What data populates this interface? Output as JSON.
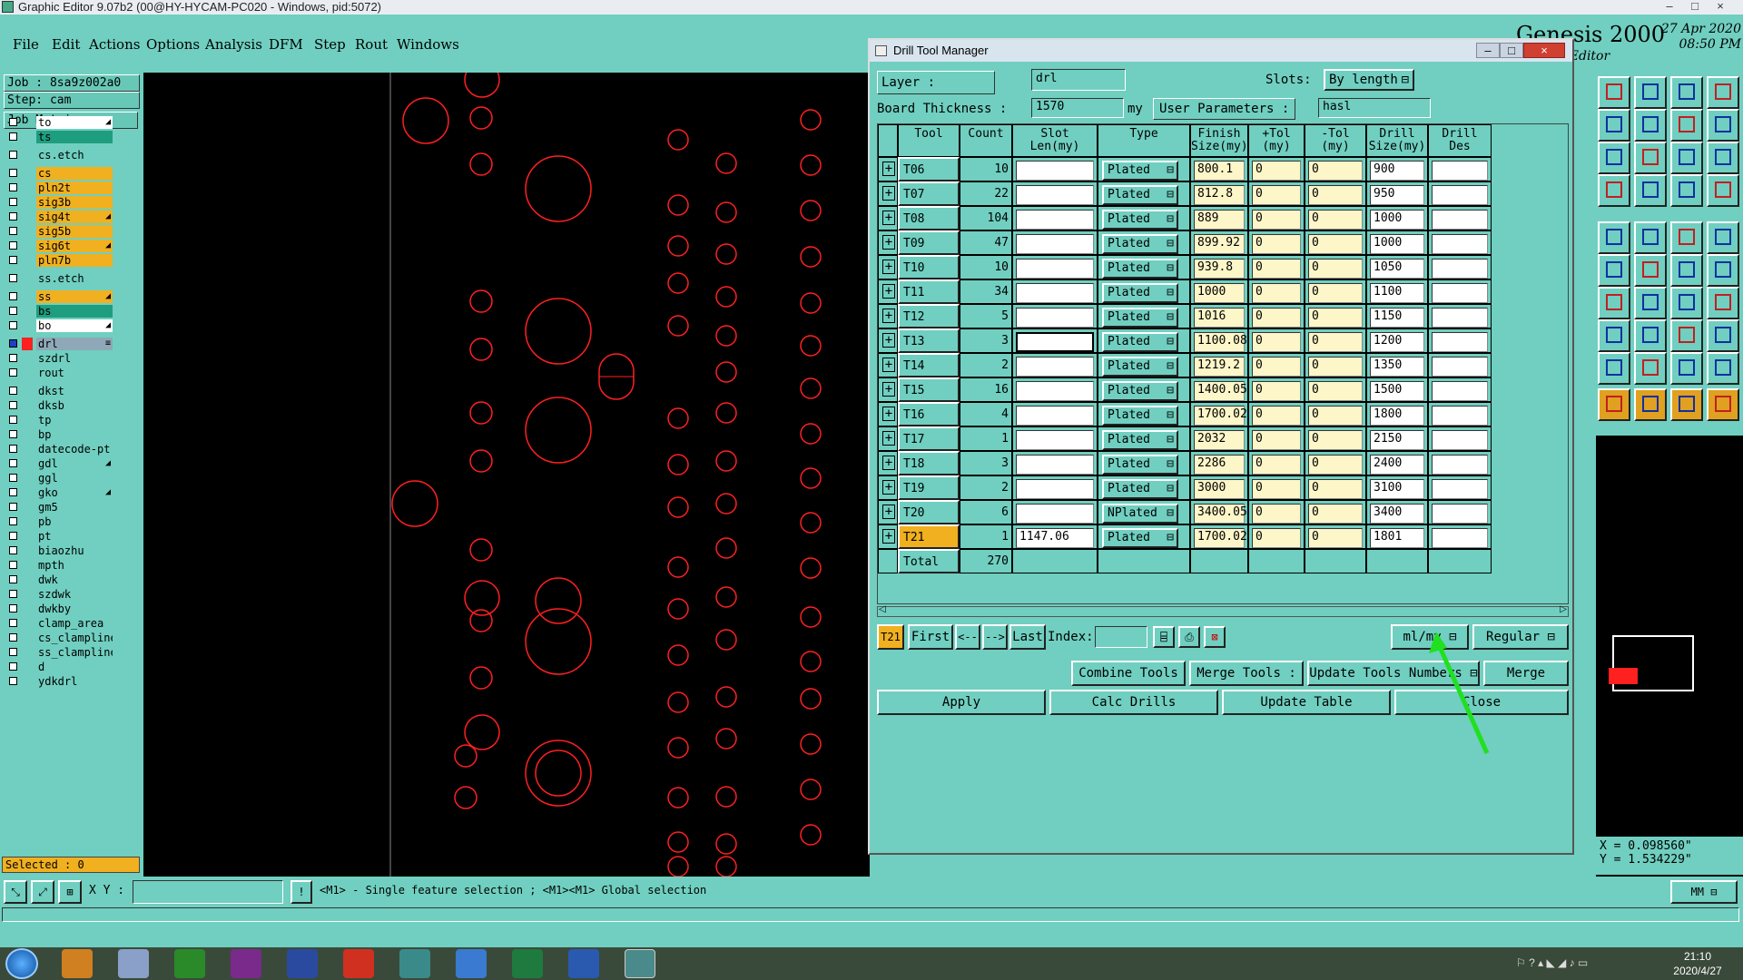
{
  "window": {
    "title": "Graphic Editor 9.07b2 (00@HY-HYCAM-PC020 - Windows, pid:5072)"
  },
  "menu": [
    "File",
    "Edit",
    "Actions",
    "Options",
    "Analysis",
    "DFM",
    "Step",
    "Rout",
    "Windows"
  ],
  "brand": {
    "name": "Genesis 2000",
    "subtitle": "ic Editor",
    "date": "27 Apr 2020",
    "time": "08:50 PM"
  },
  "job": {
    "job_label": "Job  : 8sa9z002a0",
    "step_label": "Step: cam",
    "matrix_label": "Job Matrix ..."
  },
  "layers": [
    {
      "name": "to",
      "color": "#ffffff",
      "mark": "◢"
    },
    {
      "name": "ts",
      "color": "#1e9e7e",
      "mark": ""
    },
    {
      "name": "cs.etch",
      "color": "#70cfc0",
      "mark": ""
    },
    {
      "name": "cs",
      "color": "#f0b020",
      "mark": ""
    },
    {
      "name": "pln2t",
      "color": "#f0b020",
      "mark": ""
    },
    {
      "name": "sig3b",
      "color": "#f0b020",
      "mark": ""
    },
    {
      "name": "sig4t",
      "color": "#f0b020",
      "mark": "◢"
    },
    {
      "name": "sig5b",
      "color": "#f0b020",
      "mark": ""
    },
    {
      "name": "sig6t",
      "color": "#f0b020",
      "mark": "◢"
    },
    {
      "name": "pln7b",
      "color": "#f0b020",
      "mark": ""
    },
    {
      "name": "ss.etch",
      "color": "#70cfc0",
      "mark": ""
    },
    {
      "name": "ss",
      "color": "#f0b020",
      "mark": "◢"
    },
    {
      "name": "bs",
      "color": "#1e9e7e",
      "mark": ""
    },
    {
      "name": "bo",
      "color": "#ffffff",
      "mark": "◢"
    },
    {
      "name": "drl",
      "color": "#8fa8b8",
      "mark": "≡"
    },
    {
      "name": "szdrl",
      "color": "#70cfc0",
      "mark": ""
    },
    {
      "name": "rout",
      "color": "#70cfc0",
      "mark": ""
    },
    {
      "name": "dkst",
      "color": "#70cfc0",
      "mark": ""
    },
    {
      "name": "dksb",
      "color": "#70cfc0",
      "mark": ""
    },
    {
      "name": "tp",
      "color": "#70cfc0",
      "mark": ""
    },
    {
      "name": "bp",
      "color": "#70cfc0",
      "mark": ""
    },
    {
      "name": "datecode-pt",
      "color": "#70cfc0",
      "mark": ""
    },
    {
      "name": "gdl",
      "color": "#70cfc0",
      "mark": "◢"
    },
    {
      "name": "ggl",
      "color": "#70cfc0",
      "mark": ""
    },
    {
      "name": "gko",
      "color": "#70cfc0",
      "mark": "◢"
    },
    {
      "name": "gm5",
      "color": "#70cfc0",
      "mark": ""
    },
    {
      "name": "pb",
      "color": "#70cfc0",
      "mark": ""
    },
    {
      "name": "pt",
      "color": "#70cfc0",
      "mark": ""
    },
    {
      "name": "biaozhu",
      "color": "#70cfc0",
      "mark": ""
    },
    {
      "name": "mpth",
      "color": "#70cfc0",
      "mark": ""
    },
    {
      "name": "dwk",
      "color": "#70cfc0",
      "mark": ""
    },
    {
      "name": "szdwk",
      "color": "#70cfc0",
      "mark": ""
    },
    {
      "name": "dwkby",
      "color": "#70cfc0",
      "mark": ""
    },
    {
      "name": "clamp_area",
      "color": "#70cfc0",
      "mark": ""
    },
    {
      "name": "cs_clampline",
      "color": "#70cfc0",
      "mark": ""
    },
    {
      "name": "ss_clampline",
      "color": "#70cfc0",
      "mark": ""
    },
    {
      "name": "d",
      "color": "#70cfc0",
      "mark": ""
    },
    {
      "name": "ydkdrl",
      "color": "#70cfc0",
      "mark": ""
    }
  ],
  "selected_label": "Selected : 0",
  "dialog": {
    "title": "Drill Tool Manager",
    "layer_label": "Layer          :",
    "layer_value": "drl",
    "slots_label": "Slots:",
    "slots_value": "By length",
    "board_thickness_label": "Board Thickness :",
    "board_thickness_value": "1570",
    "thickness_unit": "my",
    "user_params_label": "User Parameters :",
    "user_params_value": "hasl",
    "columns": [
      "Tool",
      "Count",
      "Slot\nLen(my)",
      "Type",
      "Finish\nSize(my)",
      "+Tol\n(my)",
      "-Tol\n(my)",
      "Drill\nSize(my)",
      "Drill\nDes"
    ],
    "rows": [
      {
        "tool": "T06",
        "count": "10",
        "slot": "",
        "type": "Plated",
        "finish": "800.1",
        "ptol": "0",
        "mtol": "0",
        "drill": "900",
        "des": ""
      },
      {
        "tool": "T07",
        "count": "22",
        "slot": "",
        "type": "Plated",
        "finish": "812.8",
        "ptol": "0",
        "mtol": "0",
        "drill": "950",
        "des": ""
      },
      {
        "tool": "T08",
        "count": "104",
        "slot": "",
        "type": "Plated",
        "finish": "889",
        "ptol": "0",
        "mtol": "0",
        "drill": "1000",
        "des": ""
      },
      {
        "tool": "T09",
        "count": "47",
        "slot": "",
        "type": "Plated",
        "finish": "899.92",
        "ptol": "0",
        "mtol": "0",
        "drill": "1000",
        "des": ""
      },
      {
        "tool": "T10",
        "count": "10",
        "slot": "",
        "type": "Plated",
        "finish": "939.8",
        "ptol": "0",
        "mtol": "0",
        "drill": "1050",
        "des": ""
      },
      {
        "tool": "T11",
        "count": "34",
        "slot": "",
        "type": "Plated",
        "finish": "1000",
        "ptol": "0",
        "mtol": "0",
        "drill": "1100",
        "des": ""
      },
      {
        "tool": "T12",
        "count": "5",
        "slot": "",
        "type": "Plated",
        "finish": "1016",
        "ptol": "0",
        "mtol": "0",
        "drill": "1150",
        "des": ""
      },
      {
        "tool": "T13",
        "count": "3",
        "slot": "",
        "type": "Plated",
        "finish": "1100.08",
        "ptol": "0",
        "mtol": "0",
        "drill": "1200",
        "des": ""
      },
      {
        "tool": "T14",
        "count": "2",
        "slot": "",
        "type": "Plated",
        "finish": "1219.2",
        "ptol": "0",
        "mtol": "0",
        "drill": "1350",
        "des": ""
      },
      {
        "tool": "T15",
        "count": "16",
        "slot": "",
        "type": "Plated",
        "finish": "1400.05",
        "ptol": "0",
        "mtol": "0",
        "drill": "1500",
        "des": ""
      },
      {
        "tool": "T16",
        "count": "4",
        "slot": "",
        "type": "Plated",
        "finish": "1700.02",
        "ptol": "0",
        "mtol": "0",
        "drill": "1800",
        "des": ""
      },
      {
        "tool": "T17",
        "count": "1",
        "slot": "",
        "type": "Plated",
        "finish": "2032",
        "ptol": "0",
        "mtol": "0",
        "drill": "2150",
        "des": ""
      },
      {
        "tool": "T18",
        "count": "3",
        "slot": "",
        "type": "Plated",
        "finish": "2286",
        "ptol": "0",
        "mtol": "0",
        "drill": "2400",
        "des": ""
      },
      {
        "tool": "T19",
        "count": "2",
        "slot": "",
        "type": "Plated",
        "finish": "3000",
        "ptol": "0",
        "mtol": "0",
        "drill": "3100",
        "des": ""
      },
      {
        "tool": "T20",
        "count": "6",
        "slot": "",
        "type": "NPlated",
        "finish": "3400.05",
        "ptol": "0",
        "mtol": "0",
        "drill": "3400",
        "des": ""
      },
      {
        "tool": "T21",
        "count": "1",
        "slot": "1147.06",
        "type": "Plated",
        "finish": "1700.02",
        "ptol": "0",
        "mtol": "0",
        "drill": "1801",
        "des": ""
      }
    ],
    "total_label": "Total",
    "total_value": "270",
    "current_tool": "T21",
    "nav": {
      "first": "First",
      "prev": "<--",
      "next": "-->",
      "last": "Last",
      "index_label": "Index:"
    },
    "units_value": "ml/my",
    "mode_value": "Regular",
    "combine": "Combine Tools",
    "merge_tools": "Merge Tools :",
    "update_numbers": "Update Tools Numbers",
    "merge": "Merge",
    "apply": "Apply",
    "calc": "Calc Drills",
    "update_table": "Update Table",
    "close": "Close"
  },
  "coords": {
    "x": "X = 0.098560\"",
    "y": "Y = 1.534229\""
  },
  "status": {
    "xy_label": "X Y :",
    "hint": "<M1> - Single feature selection ; <M1><M1> Global selection",
    "unit": "MM"
  },
  "clock": {
    "time": "21:10",
    "date": "2020/4/27"
  },
  "colors": {
    "accent": "#70cfc0",
    "drill": "#ff2020",
    "arrow": "#20e020"
  }
}
